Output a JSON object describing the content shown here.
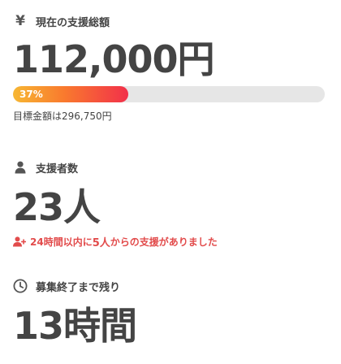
{
  "funding": {
    "label": "現在の支援総額",
    "amount": "112,000円",
    "progress_text": "37%",
    "progress_percent": 37,
    "target_text": "目標金額は296,750円"
  },
  "supporters": {
    "label": "支援者数",
    "count": "23人",
    "recent_prefix": "24時間以内に",
    "recent_count": "5人",
    "recent_suffix": "からの支援がありました"
  },
  "remaining": {
    "label": "募集終了まで残り",
    "value": "13時間"
  },
  "icons": {
    "funding": "yen-icon",
    "supporters": "person-icon",
    "recent": "person-add-icon",
    "remaining": "clock-icon"
  },
  "colors": {
    "text": "#444444",
    "accent_red": "#e24b4b",
    "progress_start": "#f7b733",
    "progress_end": "#f2304a",
    "track": "#e6e6e6"
  }
}
